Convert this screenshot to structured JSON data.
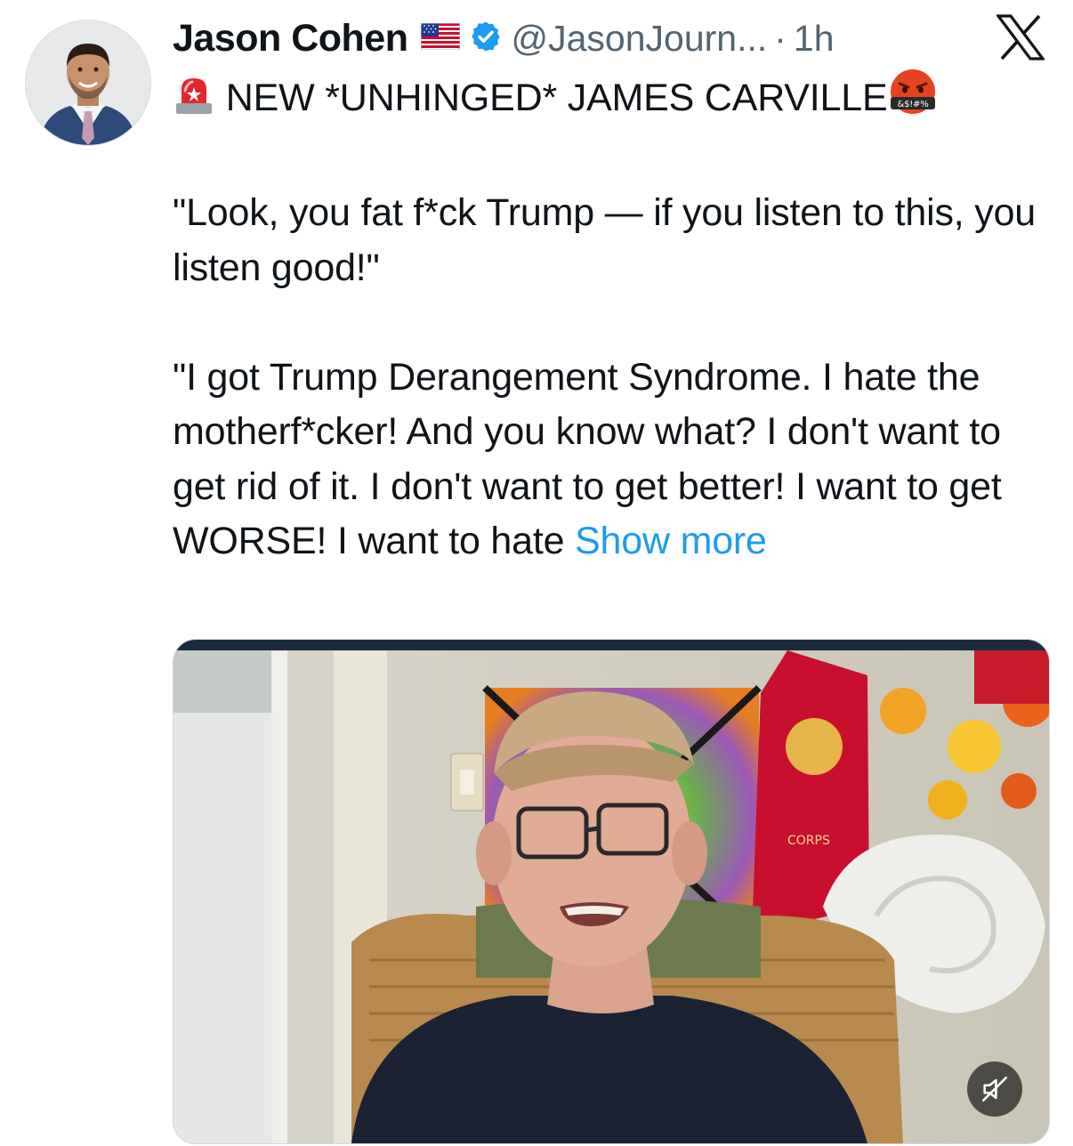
{
  "author": {
    "name": "Jason Cohen",
    "handle": "@JasonJourn...",
    "separator": "·",
    "time": "1h"
  },
  "icons": {
    "flag": "us-flag-icon",
    "verified": "verified-badge-icon",
    "platform": "x-logo-icon",
    "siren": "police-siren-emoji",
    "cursing": "face-with-symbols-on-mouth-emoji",
    "mute": "muted-speaker-icon"
  },
  "tweet": {
    "line1": "NEW *UNHINGED* JAMES CARVILLE",
    "paragraph1": "\"Look, you fat f*ck Trump — if you listen to this, you listen good!\"",
    "paragraph2": "\"I got Trump Derangement Syndrome. I hate the motherf*cker! And you know what? I don't want to get rid of it. I don't want to get better! I want to get WORSE! I want to hate",
    "show_more": "Show more"
  },
  "colors": {
    "accent": "#1d9bf0",
    "secondary_text": "#536471",
    "primary_text": "#0f1419"
  }
}
